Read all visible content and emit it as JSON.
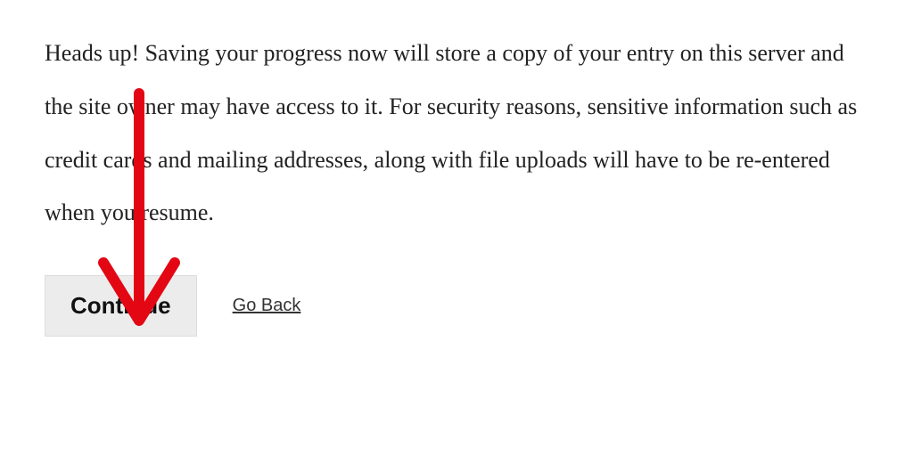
{
  "message": "Heads up! Saving your progress now will store a copy of your entry on this server and the site owner may have access to it. For security reasons, sensitive information such as credit cards and mailing addresses, along with file uploads will have to be re-entered when you resume.",
  "actions": {
    "continue_label": "Continue",
    "go_back_label": "Go Back"
  },
  "annotation": {
    "color": "#e30613"
  }
}
